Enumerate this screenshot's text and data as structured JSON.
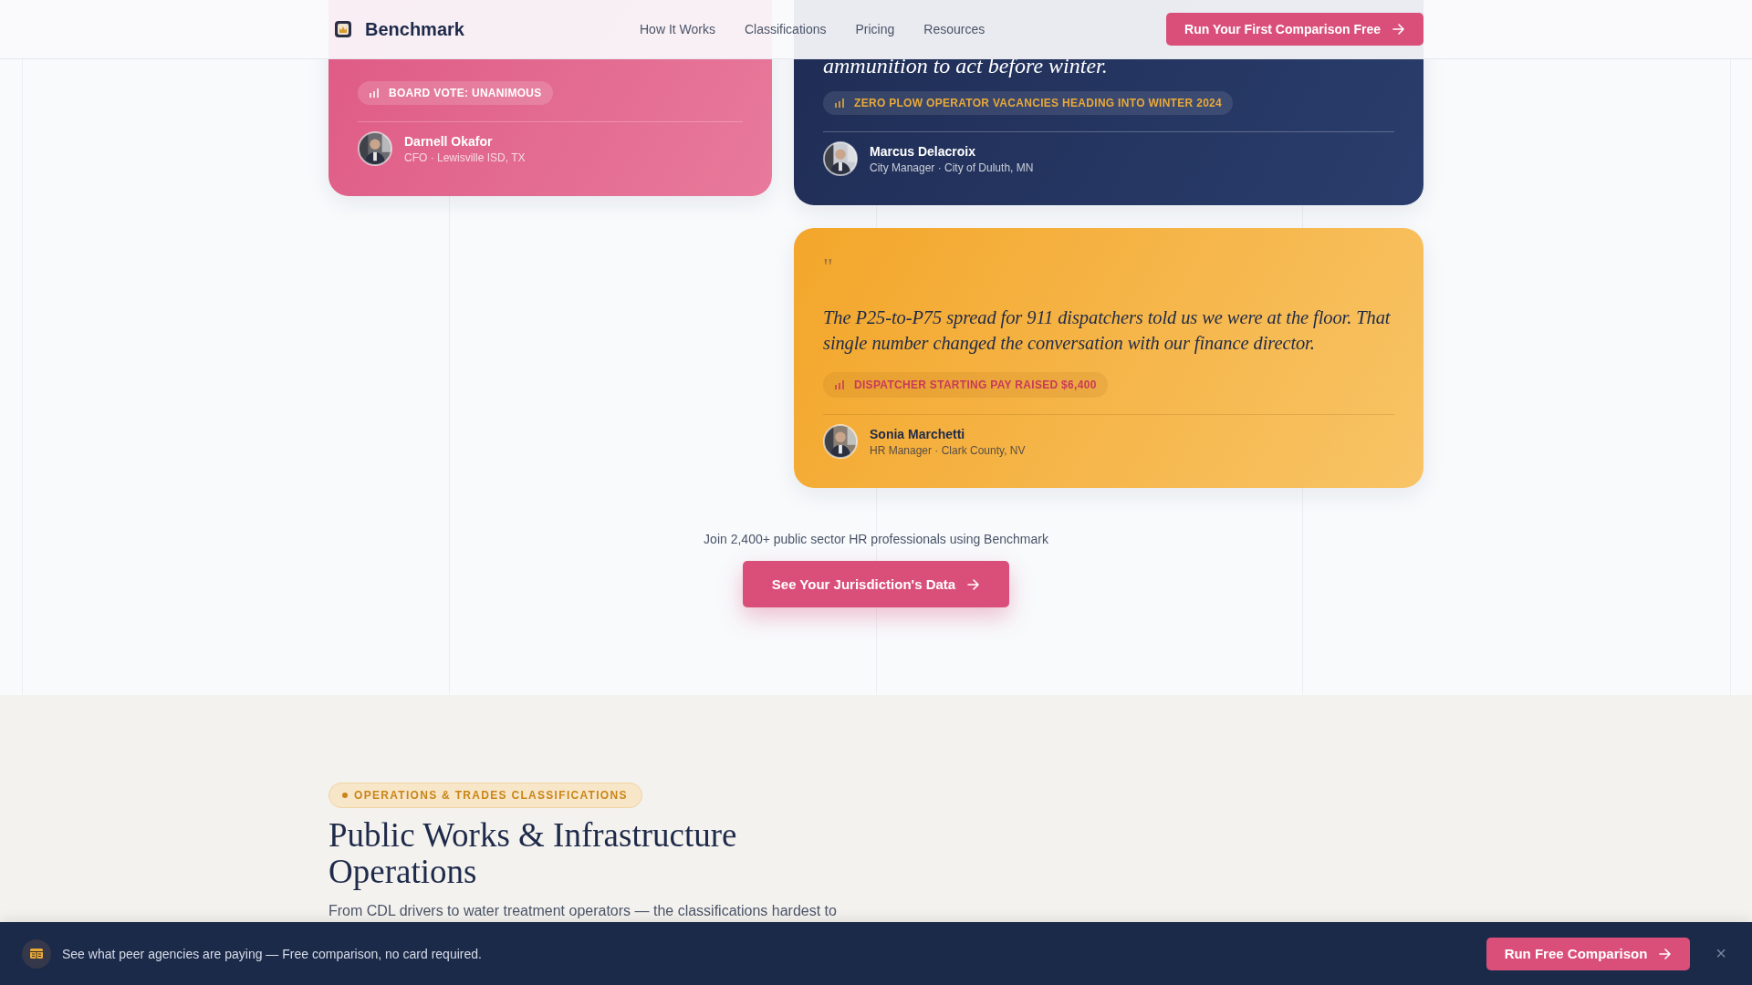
{
  "header": {
    "brand": "Benchmark",
    "nav": [
      {
        "label": "How It Works"
      },
      {
        "label": "Classifications"
      },
      {
        "label": "Pricing"
      },
      {
        "label": "Resources"
      }
    ],
    "cta": "Run Your First Comparison Free"
  },
  "testimonial_columns": [
    {
      "cards": [
        {
          "kind": "pink",
          "badge": "BOARD VOTE: UNANIMOUS",
          "name": "Darnell Okafor",
          "role": "CFO · Lewisville ISD, TX"
        }
      ]
    },
    {
      "cards": [
        {
          "kind": "navy",
          "quote": "ammunition to act before winter.",
          "badge": "ZERO PLOW OPERATOR VACANCIES HEADING INTO WINTER 2024",
          "name": "Marcus Delacroix",
          "role": "City Manager · City of Duluth, MN"
        },
        {
          "kind": "amber",
          "quote_mark": "\"",
          "quote": "The P25-to-P75 spread for 911 dispatchers told us we were at the floor. That single number changed the conversation with our finance director.",
          "badge": "DISPATCHER STARTING PAY RAISED $6,400",
          "name": "Sonia Marchetti",
          "role": "HR Manager · Clark County, NV"
        }
      ]
    }
  ],
  "cta": {
    "caption": "Join 2,400+ public sector HR professionals using Benchmark",
    "button": "See Your Jurisdiction's Data"
  },
  "section": {
    "tag": "OPERATIONS & TRADES CLASSIFICATIONS",
    "heading": "Public Works & Infrastructure Operations",
    "intro": "From CDL drivers to water treatment operators — the classifications hardest to"
  },
  "banner": {
    "text": "See what peer agencies are paying — Free comparison, no card required.",
    "button": "Run Free Comparison",
    "close": "×"
  }
}
